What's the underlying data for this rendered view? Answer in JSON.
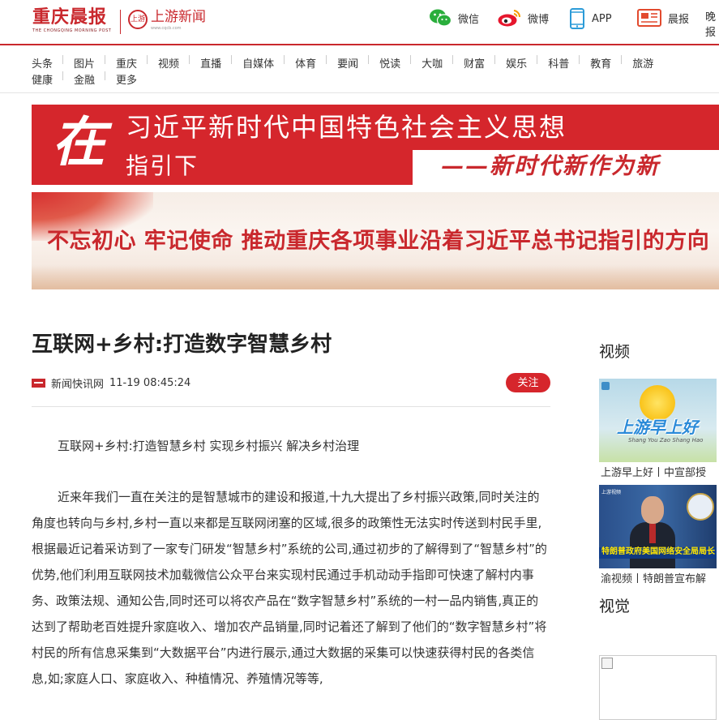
{
  "header": {
    "logo_cn": "重庆晨报",
    "logo_en": "THE CHONGQING MORNING POST",
    "partner_badge": "上游",
    "partner_name": "上游新闻",
    "partner_domain": "www.cqcb.com",
    "share": [
      {
        "icon": "wechat-icon",
        "label": "微信"
      },
      {
        "icon": "weibo-icon",
        "label": "微博"
      },
      {
        "icon": "mobile-app-icon",
        "label": "APP"
      },
      {
        "icon": "newspaper-icon",
        "label": "晨报"
      },
      {
        "icon": "",
        "label": "晚报"
      }
    ]
  },
  "nav": {
    "row1": [
      "头条",
      "图片",
      "重庆",
      "视频",
      "直播",
      "自媒体",
      "体育",
      "要闻",
      "悦读",
      "大咖",
      "财富",
      "娱乐",
      "科普",
      "教育",
      "旅游"
    ],
    "row2": [
      "健康",
      "金融",
      "更多"
    ]
  },
  "banner1": {
    "big_char": "在",
    "line1": "习近平新时代中国特色社会主义思想",
    "line2": "指引下",
    "slogan": "——新时代新作为新"
  },
  "banner2": {
    "text": "不忘初心 牢记使命 推动重庆各项事业沿着习近平总书记指引的方向"
  },
  "article": {
    "title": "互联网+乡村:打造数字智慧乡村",
    "source": "新闻快讯网",
    "time": "11-19 08:45:24",
    "follow_label": "关注",
    "paragraphs": [
      "互联网+乡村:打造智慧乡村 实现乡村振兴 解决乡村治理",
      "近来年我们一直在关注的是智慧城市的建设和报道,十九大提出了乡村振兴政策,同时关注的角度也转向与乡村,乡村一直以来都是互联网闭塞的区域,很多的政策性无法实时传送到村民手里,根据最近记着采访到了一家专门研发“智慧乡村”系统的公司,通过初步的了解得到了“智慧乡村”的优势,他们利用互联网技术加载微信公众平台来实现村民通过手机动动手指即可快速了解村内事务、政策法规、通知公告,同时还可以将农产品在“数字智慧乡村”系统的一村一品内销售,真正的达到了帮助老百姓提升家庭收入、增加农产品销量,同时记着还了解到了他们的“数字智慧乡村”将村民的所有信息采集到“大数据平台”内进行展示,通过大数据的采集可以快速获得村民的各类信息,如;家庭人口、家庭收入、种植情况、养殖情况等等,"
    ]
  },
  "sidebar": {
    "video_heading": "视频",
    "videos": [
      {
        "thumb_text": "上游早上好",
        "thumb_sub": "Shang You Zao Shang Hao",
        "caption": "上游早上好丨中宣部授"
      },
      {
        "thumb_text": "特朗普政府美国网络安全局局长",
        "thumb_logo": "上游视频",
        "caption": "渝视频丨特朗普宣布解"
      }
    ],
    "visual_heading": "视觉"
  },
  "colors": {
    "brand_red": "#c9282d",
    "follow_button": "#d6262c"
  }
}
